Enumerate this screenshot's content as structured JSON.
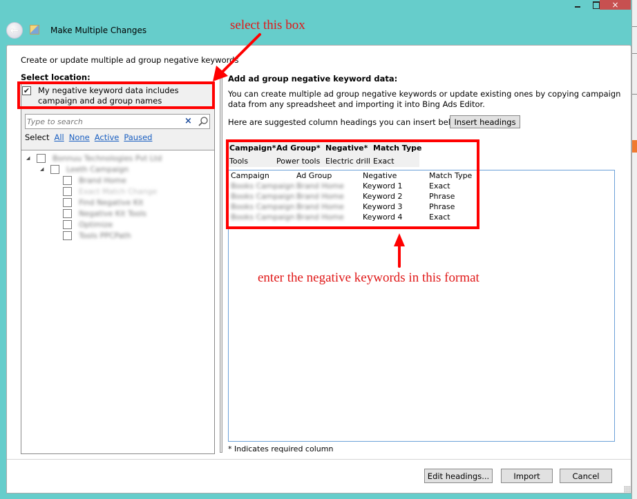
{
  "window": {
    "title": "Make Multiple Changes",
    "controls": {
      "minimize": "minimize",
      "maximize": "maximize",
      "close": "×"
    },
    "back_icon": "←"
  },
  "dialog": {
    "intro": "Create or update multiple ad group negative keywords",
    "select_location_label": "Select location:",
    "include_names_checkbox": {
      "label": "My negative keyword data includes campaign and ad group names",
      "checked": true,
      "check_glyph": "✔"
    },
    "search": {
      "placeholder": "Type to search",
      "value": "",
      "clear_icon": "×"
    },
    "select_filters": {
      "label": "Select",
      "links": [
        "All",
        "None",
        "Active",
        "Paused"
      ]
    },
    "tree": {
      "items": [
        {
          "level": 0,
          "expanded": true,
          "expander": "◢",
          "label": "Bonnuu Technologies Pvt Ltd",
          "blurred": true,
          "checked": false
        },
        {
          "level": 1,
          "expanded": true,
          "expander": "◢",
          "label": "Leeth Campaign",
          "blurred": true,
          "checked": false
        },
        {
          "level": 2,
          "label": "Brand Home",
          "blurred": true,
          "checked": false
        },
        {
          "level": 2,
          "label": "Exact Match Change",
          "blurred": true,
          "faint": true,
          "checked": false
        },
        {
          "level": 2,
          "label": "Find Negative Kit",
          "blurred": true,
          "checked": false
        },
        {
          "level": 2,
          "label": "Negative Kit Tools",
          "blurred": true,
          "checked": false
        },
        {
          "level": 2,
          "label": "Optimize",
          "blurred": true,
          "checked": false
        },
        {
          "level": 2,
          "label": "Tools PPCPath",
          "blurred": true,
          "checked": false
        }
      ]
    },
    "right": {
      "heading": "Add ad group negative keyword data:",
      "description": "You can create multiple ad group negative keywords or update existing ones by copying campaign data from any spreadsheet and importing it into Bing Ads Editor.",
      "suggest_text": "Here are suggested column headings you can insert below:",
      "insert_headings_button": "Insert headings",
      "sample_table": {
        "headers": [
          "Campaign*",
          "Ad Group*",
          "Negative*",
          "Match Type"
        ],
        "row": [
          "Tools",
          "Power tools",
          "Electric drill",
          "Exact"
        ]
      },
      "data_entry": {
        "headers": [
          "Campaign",
          "Ad Group",
          "Negative",
          "Match Type"
        ],
        "rows": [
          [
            "Books Campaign",
            "Brand Home",
            "Keyword 1",
            "Exact"
          ],
          [
            "Books Campaign",
            "Brand Home",
            "Keyword 2",
            "Phrase"
          ],
          [
            "Books Campaign",
            "Brand Home",
            "Keyword 3",
            "Phrase"
          ],
          [
            "Books Campaign",
            "Brand Home",
            "Keyword 4",
            "Exact"
          ]
        ],
        "blurred_columns": [
          0,
          1
        ]
      },
      "required_note": "* Indicates required column"
    },
    "footer": {
      "edit_headings_button": "Edit headings...",
      "import_button": "Import",
      "cancel_button": "Cancel"
    }
  },
  "annotations": {
    "select_box": "select this box",
    "enter_format": "enter the negative keywords in this format",
    "color": "#ff0000"
  }
}
